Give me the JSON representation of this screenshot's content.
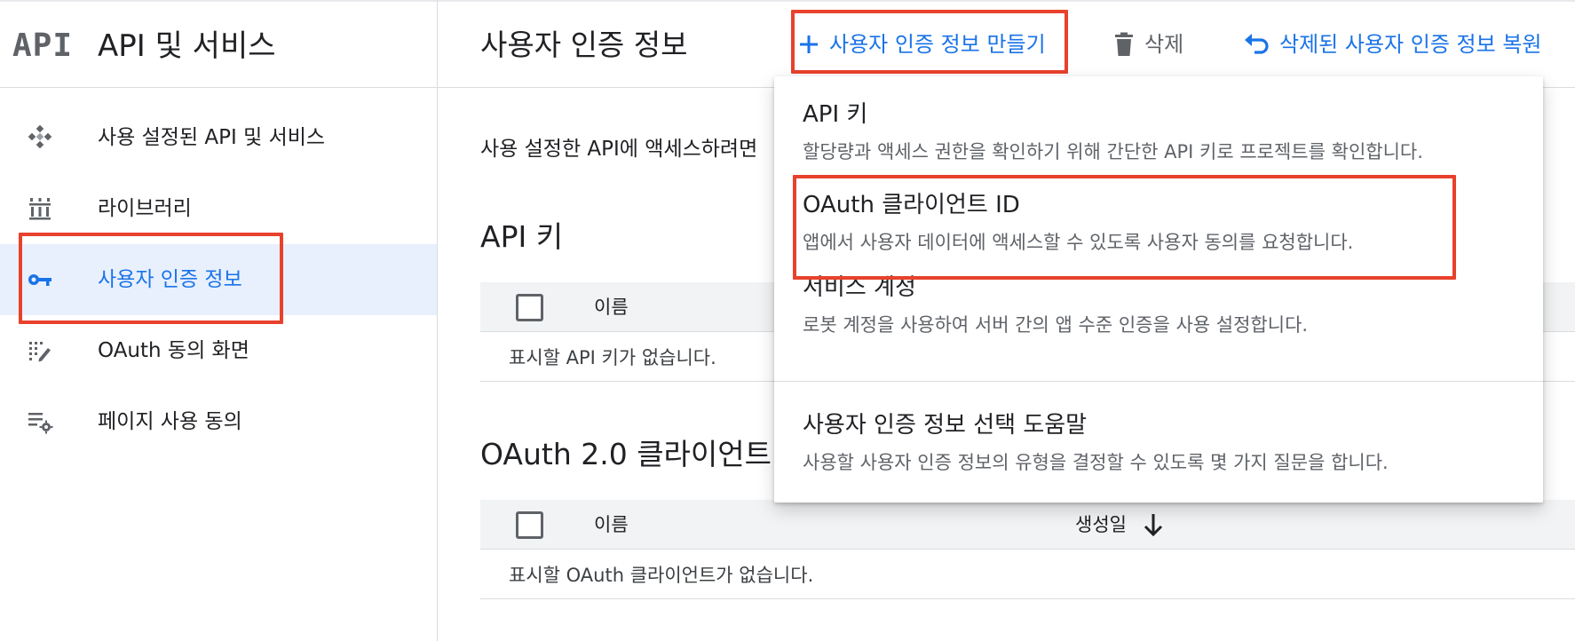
{
  "sidebar": {
    "logo_text": "API",
    "title": "API 및 서비스",
    "items": [
      {
        "label": "사용 설정된 API 및 서비스",
        "icon": "diamond-dots-icon",
        "active": false
      },
      {
        "label": "라이브러리",
        "icon": "library-icon",
        "active": false
      },
      {
        "label": "사용자 인증 정보",
        "icon": "key-icon",
        "active": true
      },
      {
        "label": "OAuth 동의 화면",
        "icon": "consent-screen-icon",
        "active": false
      },
      {
        "label": "페이지 사용 동의",
        "icon": "settings-list-icon",
        "active": false
      }
    ]
  },
  "header": {
    "title": "사용자 인증 정보",
    "create_label": "사용자 인증 정보 만들기",
    "delete_label": "삭제",
    "restore_label": "삭제된 사용자 인증 정보 복원"
  },
  "main": {
    "intro_text": "사용 설정한 API에 액세스하려면",
    "api_keys": {
      "title": "API 키",
      "col_name": "이름",
      "empty": "표시할 API 키가 없습니다."
    },
    "oauth": {
      "title": "OAuth 2.0 클라이언트",
      "col_name": "이름",
      "col_created": "생성일",
      "empty": "표시할 OAuth 클라이언트가 없습니다."
    }
  },
  "dropdown": {
    "items": [
      {
        "title": "API 키",
        "desc": "할당량과 액세스 권한을 확인하기 위해 간단한 API 키로 프로젝트를 확인합니다."
      },
      {
        "title": "OAuth 클라이언트 ID",
        "desc": "앱에서 사용자 데이터에 액세스할 수 있도록 사용자 동의를 요청합니다."
      },
      {
        "title": "서비스 계정",
        "desc": "로봇 계정을 사용하여 서버 간의 앱 수준 인증을 사용 설정합니다."
      },
      {
        "title": "사용자 인증 정보 선택 도움말",
        "desc": "사용할 사용자 인증 정보의 유형을 결정할 수 있도록 몇 가지 질문을 합니다."
      }
    ]
  },
  "colors": {
    "accent": "#1a73e8",
    "highlight": "#e8412c",
    "active_bg": "#e8f0fe"
  }
}
